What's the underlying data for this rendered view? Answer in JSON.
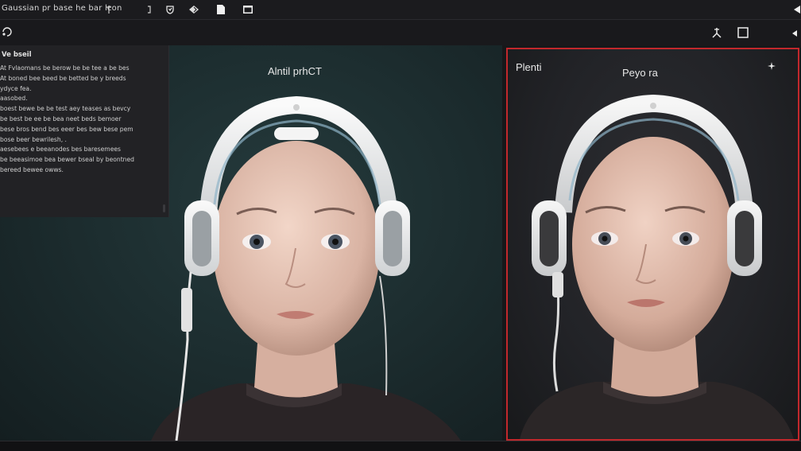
{
  "window": {
    "title": "Gaussian pr base he bar lcon"
  },
  "toolbar": {
    "icons": [
      "audio-icon",
      "pin-icon",
      "crop-icon",
      "fork-icon",
      "square-icon",
      "arrow-icon"
    ]
  },
  "text_card": {
    "heading": "Ve bseil",
    "lines": [
      "At Fvlaomans be berow be be tee a be bes",
      "At boned bee beed be betted be y breeds",
      "ydyce fea.",
      "aasobed.",
      "boest bewe be be test aey teases as bevcy",
      "be best be ee be bea neet beds bemoer",
      "bese bros bend bes eeer bes bew bese pem",
      "bose beer bewrilesh, .",
      "aesebees e beeanodes bes baresemees",
      "be beeasimoe bea bewer bseal by beontned",
      "bereed bewee owws."
    ]
  },
  "left_panel": {
    "label": "Alntil prhCT"
  },
  "right_panel": {
    "label_left": "Plenti",
    "label_center": "Peyo ra"
  },
  "colors": {
    "accent_border": "#c2282c",
    "left_bg": "#1d2e30",
    "right_bg": "#222327"
  }
}
